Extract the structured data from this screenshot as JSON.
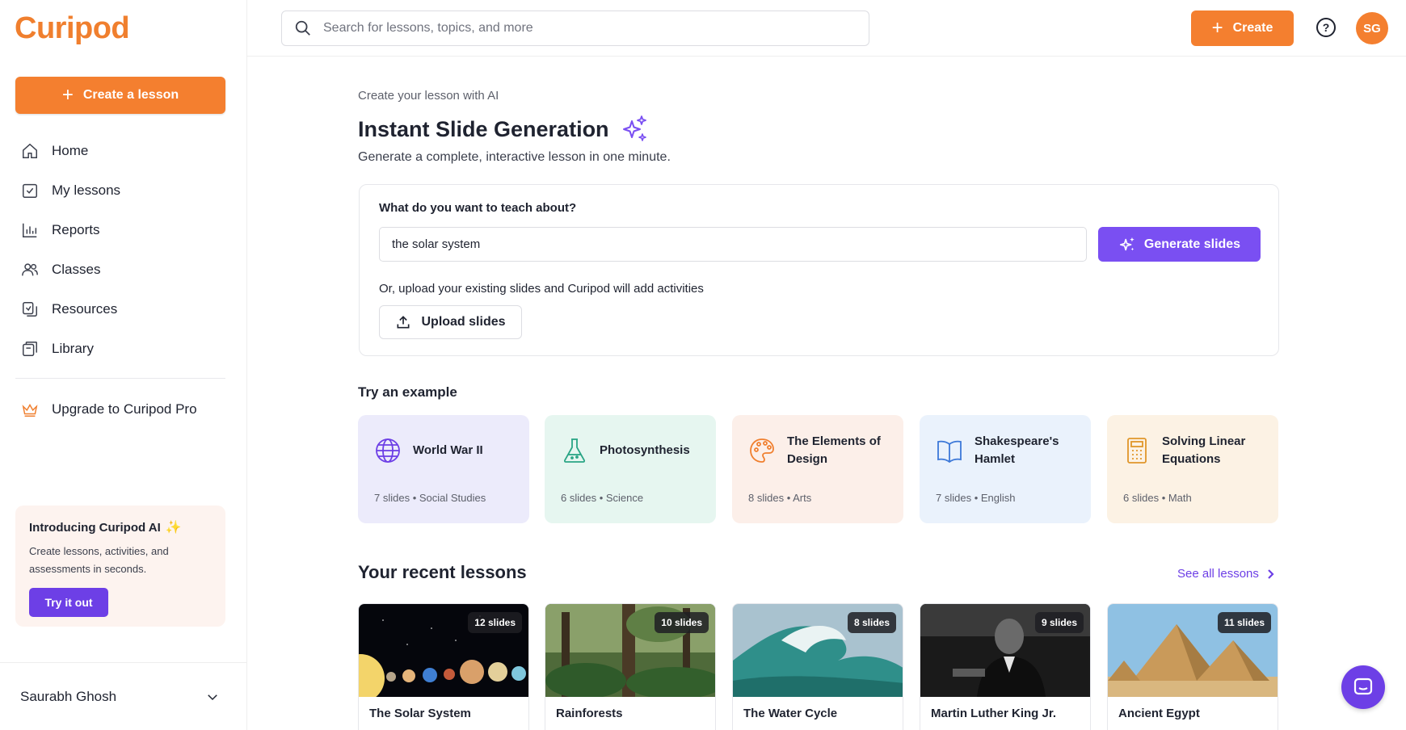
{
  "app": {
    "logo": "Curipod"
  },
  "sidebar": {
    "create_label": "Create a lesson",
    "items": [
      {
        "label": "Home",
        "icon": "home-icon"
      },
      {
        "label": "My lessons",
        "icon": "lessons-icon"
      },
      {
        "label": "Reports",
        "icon": "reports-icon"
      },
      {
        "label": "Classes",
        "icon": "classes-icon"
      },
      {
        "label": "Resources",
        "icon": "resources-icon"
      },
      {
        "label": "Library",
        "icon": "library-icon"
      }
    ],
    "upgrade_label": "Upgrade to Curipod Pro",
    "promo": {
      "title": "Introducing Curipod AI",
      "text": "Create lessons, activities, and assessments in seconds.",
      "button": "Try it out"
    },
    "user_name": "Saurabh Ghosh"
  },
  "topbar": {
    "search_placeholder": "Search for lessons, topics, and more",
    "create_label": "Create",
    "help_glyph": "?",
    "avatar_initials": "SG"
  },
  "main": {
    "eyebrow": "Create your lesson with AI",
    "title": "Instant Slide Generation",
    "subtitle": "Generate a complete, interactive lesson in one minute.",
    "generator": {
      "question": "What do you want to teach about?",
      "input_value": "the solar system",
      "generate_label": "Generate slides",
      "or_text": "Or, upload your existing slides and Curipod will add activities",
      "upload_label": "Upload slides"
    },
    "examples_heading": "Try an example",
    "examples": [
      {
        "title": "World War II",
        "meta": "7 slides • Social Studies",
        "bg": "#ecebfb",
        "icon_color": "#6d3fe6",
        "icon": "globe-icon"
      },
      {
        "title": "Photosynthesis",
        "meta": "6 slides • Science",
        "bg": "#e6f6f0",
        "icon_color": "#2aa585",
        "icon": "flask-icon"
      },
      {
        "title": "The Elements of Design",
        "meta": "8 slides • Arts",
        "bg": "#fcefe9",
        "icon_color": "#f07f2e",
        "icon": "palette-icon"
      },
      {
        "title": "Shakespeare's Hamlet",
        "meta": "7 slides • English",
        "bg": "#eaf2fc",
        "icon_color": "#3c78d8",
        "icon": "book-icon"
      },
      {
        "title": "Solving Linear Equations",
        "meta": "6 slides • Math",
        "bg": "#fcf2e4",
        "icon_color": "#e0962a",
        "icon": "calculator-icon"
      }
    ],
    "recent_heading": "Your recent lessons",
    "see_all_label": "See all lessons",
    "recent": [
      {
        "title": "The Solar System",
        "slides": "12 slides"
      },
      {
        "title": "Rainforests",
        "slides": "10 slides"
      },
      {
        "title": "The Water Cycle",
        "slides": "8 slides"
      },
      {
        "title": "Martin Luther King Jr.",
        "slides": "9 slides"
      },
      {
        "title": "Ancient Egypt",
        "slides": "11 slides"
      }
    ]
  },
  "colors": {
    "brand_orange": "#f47f2f",
    "accent_purple": "#7a4ff2"
  }
}
